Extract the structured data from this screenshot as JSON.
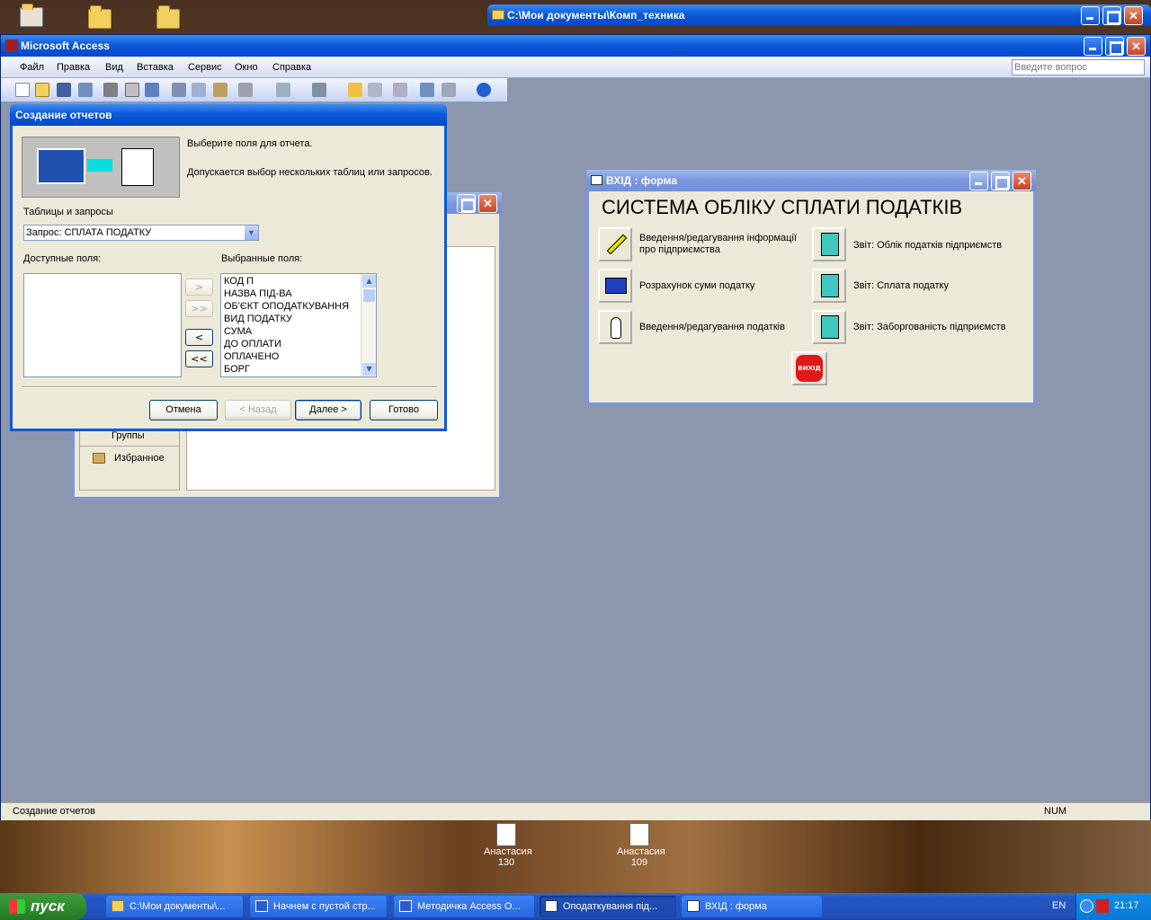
{
  "desktop": {
    "icons": [
      {
        "label": "Анастасия\n130",
        "line1": "Анастасия",
        "line2": "130"
      },
      {
        "label": "Анастасия\n109",
        "line1": "Анастасия",
        "line2": "109"
      }
    ]
  },
  "explorer_window": {
    "title": "C:\\Мои документы\\Комп_техника"
  },
  "access": {
    "title": "Microsoft Access",
    "menu": [
      "Файл",
      "Правка",
      "Вид",
      "Вставка",
      "Сервис",
      "Окно",
      "Справка"
    ],
    "question_placeholder": "Введите вопрос",
    "status": "Создание отчетов",
    "status_num": "NUM"
  },
  "db_window": {
    "groups_label": "Группы",
    "favorites_label": "Избранное"
  },
  "wizard": {
    "title": "Создание отчетов",
    "prompt1": "Выберите поля для отчета.",
    "prompt2": "Допускается выбор нескольких таблиц или запросов.",
    "tables_label": "Таблицы и запросы",
    "tables_value": "Запрос: СПЛАТА ПОДАТКУ",
    "available_label": "Доступные поля:",
    "selected_label": "Выбранные поля:",
    "selected_fields": [
      "КОД П",
      "НАЗВА ПІД-ВА",
      "ОБ'ЄКТ ОПОДАТКУВАННЯ",
      "ВИД ПОДАТКУ",
      "СУМА",
      "ДО ОПЛАТИ",
      "ОПЛАЧЕНО",
      "БОРГ"
    ],
    "move_one": ">",
    "move_all": ">>",
    "remove_one": "<",
    "remove_all": "<<",
    "cancel": "Отмена",
    "back": "< Назад",
    "next": "Далее >",
    "finish": "Готово"
  },
  "form": {
    "title": "ВХІД : форма",
    "heading": "СИСТЕМА ОБЛІКУ СПЛАТИ ПОДАТКІВ",
    "left_items": [
      {
        "label": "Введення/редагування інформації про підприємства",
        "icon": "pencil-icon"
      },
      {
        "label": "Розрахунок суми податку",
        "icon": "calculator-icon"
      },
      {
        "label": "Введення/редагування податків",
        "icon": "hand-icon"
      }
    ],
    "right_items": [
      {
        "label": "Звіт: Облік податків підприємств",
        "icon": "notebook-icon"
      },
      {
        "label": "Звіт: Сплата податку",
        "icon": "notebook-icon"
      },
      {
        "label": "Звіт: Заборгованість підприємств",
        "icon": "notebook-icon"
      }
    ],
    "exit_label": "ВИХІД"
  },
  "taskbar": {
    "start": "пуск",
    "tasks": [
      {
        "label": "C:\\Мои документы\\...",
        "active": false
      },
      {
        "label": "Начнем с пустой стр...",
        "active": false
      },
      {
        "label": "Методичка Access О...",
        "active": false
      },
      {
        "label": "Оподаткування під...",
        "active": true
      },
      {
        "label": "ВХІД : форма",
        "active": false
      }
    ],
    "lang": "EN",
    "time": "21:17"
  }
}
